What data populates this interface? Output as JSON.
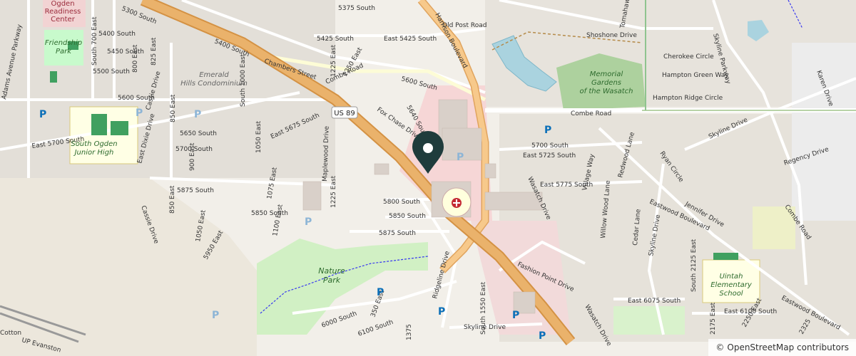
{
  "attribution": {
    "symbol": "©",
    "text": "OpenStreetMap contributors"
  },
  "colors": {
    "marker": "#1f3c3c",
    "motorway": "#e8b36d",
    "hospital": "#c42a33",
    "parking": "#0b6fb8"
  },
  "roads": {
    "s5375": "5375 South",
    "s5300": "5300 South",
    "s5400": "5400 South",
    "s5425": "5425 South",
    "es5425": "East 5425 South",
    "s5450": "5450 South",
    "s5500": "5500 South",
    "s5600": "5600 South",
    "s5600b": "5600 South",
    "s5650": "5650 South",
    "s5700": "5700 South",
    "s5700b": "5700 South",
    "e5700s": "East 5700 South",
    "e5725s": "East 5725 South",
    "e5675s": "East 5675 South",
    "s5875": "5875 South",
    "s5875b": "5875 South",
    "s5800": "5800 South",
    "s5850": "5850 South",
    "s5850b": "5850 South",
    "e5775s": "East 5775 South",
    "e6075s": "East 6075 South",
    "e6100s": "East 6100 South",
    "s6000": "6000 South",
    "s6100": "6100 South",
    "adams": "Adams Avenue Parkway",
    "harrison": "Harrison Boulevard",
    "chambers": "Chambers Street",
    "combe": "Combe Road",
    "combe2": "Combe Road",
    "combe3": "Combe Road",
    "oldpost": "Old Post Road",
    "shoshone": "Shoshone Drive",
    "skylinepkwy": "Skyline Parkway",
    "skylinedr": "Skyline Drive",
    "skylinedr2": "Skyline Drive",
    "skylinedr3": "Skyline Drive",
    "wasatch": "Wasatch Drive",
    "wasatch2": "Wasatch Drive",
    "eastwood": "Eastwood Boulevard",
    "eastwood2": "Eastwood Boulevard",
    "foxchase": "Fox Chase Drive",
    "ridgeline": "Ridgeline Drive",
    "cherokee": "Cherokee Circle",
    "hamptongreen": "Hampton Green Way",
    "hamptonridge": "Hampton Ridge Circle",
    "regency": "Regency Drive",
    "jennifer": "Jennifer Drive",
    "ryan": "Ryan Circle",
    "redwood": "Redwood Lane",
    "village": "Village Way",
    "willow": "Willow Wood Lane",
    "cedar": "Cedar Lane",
    "fashion": "Fashion Point Drive",
    "karen": "Karen Drive",
    "tomahawk": "Tomahawk",
    "cassie": "Cassie Drive",
    "cassie2": "Cassie Drive",
    "eastdixie": "East Dixie Drive",
    "maplewood": "Maplewood Drive",
    "e700": "South 700 East",
    "e800": "800 East",
    "e825": "825 East",
    "e850": "850 East",
    "e850b": "850 East",
    "e900": "900 East",
    "e1000": "South 1000 East",
    "e1050": "1050 East",
    "e1050b": "1050 East",
    "e1075": "1075 East",
    "e1100": "1100 East",
    "e1225": "1225 East",
    "e1225b": "1225 East",
    "e1250": "1250 East",
    "e1375": "1375",
    "e1550": "South 1550 East",
    "e350": "350 East",
    "s5640": "5640 South",
    "s2125": "South 2125 East",
    "s2175": "2175 East",
    "s2250": "2250 East",
    "s2325": "2325",
    "e5950": "5950 East",
    "skyline_bottom": "Skyline Drive",
    "uplabel": "UP Evanston",
    "cotton": "Cotton"
  },
  "areas": {
    "ogden_readiness": "Ogden\nReadiness\nCenter",
    "friendship": "Friendship\nPark",
    "emerald": "Emerald\nHills Condominium",
    "south_ogden_jh": "South Ogden\nJunior High",
    "memorial": "Memorial\nGardens\nof the Wasatch",
    "nature_park": "Nature\nPark",
    "uintah": "Uintah\nElementary\nSchool"
  },
  "shield": {
    "us89": "US 89"
  },
  "parking_label": "P"
}
